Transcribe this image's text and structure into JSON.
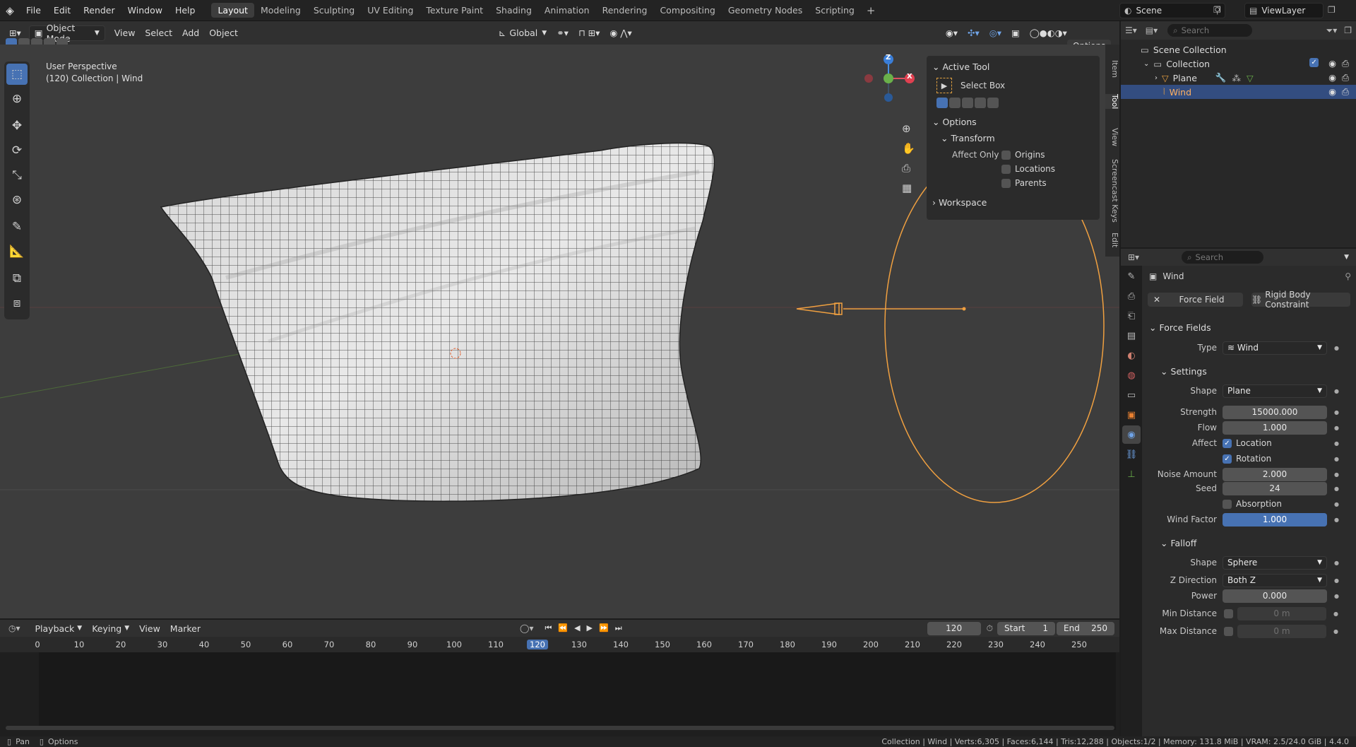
{
  "topbar": {
    "menus": [
      "File",
      "Edit",
      "Render",
      "Window",
      "Help"
    ],
    "workspaces": [
      "Layout",
      "Modeling",
      "Sculpting",
      "UV Editing",
      "Texture Paint",
      "Shading",
      "Animation",
      "Rendering",
      "Compositing",
      "Geometry Nodes",
      "Scripting"
    ],
    "active_workspace": "Layout",
    "scene": "Scene",
    "view_layer": "ViewLayer"
  },
  "viewport_header": {
    "mode": "Object Mode",
    "menus": [
      "View",
      "Select",
      "Add",
      "Object"
    ],
    "orientation": "Global",
    "options": "Options"
  },
  "viewport": {
    "view_name": "User Perspective",
    "context": "(120) Collection | Wind",
    "gizmo": {
      "z": "Z",
      "x": "X"
    }
  },
  "npanel": {
    "active_tool_title": "Active Tool",
    "tool_name": "Select Box",
    "options_title": "Options",
    "transform_title": "Transform",
    "affect_only": "Affect Only",
    "affect_items": [
      "Origins",
      "Locations",
      "Parents"
    ],
    "workspace_title": "Workspace",
    "tabs": [
      "Item",
      "Tool",
      "View",
      "Screencast Keys",
      "Edit"
    ]
  },
  "outliner": {
    "search_placeholder": "Search",
    "root": "Scene Collection",
    "collection": "Collection",
    "objects": [
      {
        "name": "Plane",
        "selected": false
      },
      {
        "name": "Wind",
        "selected": true
      }
    ]
  },
  "properties": {
    "search_placeholder": "Search",
    "object_name": "Wind",
    "tab_force_field": "Force Field",
    "tab_rigid": "Rigid Body Constraint",
    "section_force_fields": "Force Fields",
    "type_label": "Type",
    "type_value": "Wind",
    "section_settings": "Settings",
    "shape_label": "Shape",
    "shape_value": "Plane",
    "strength_label": "Strength",
    "strength_value": "15000.000",
    "flow_label": "Flow",
    "flow_value": "1.000",
    "affect_label": "Affect",
    "affect_location": "Location",
    "affect_rotation": "Rotation",
    "noise_label": "Noise Amount",
    "noise_value": "2.000",
    "seed_label": "Seed",
    "seed_value": "24",
    "absorption": "Absorption",
    "wind_factor_label": "Wind Factor",
    "wind_factor_value": "1.000",
    "section_falloff": "Falloff",
    "falloff_shape_label": "Shape",
    "falloff_shape_value": "Sphere",
    "zdir_label": "Z Direction",
    "zdir_value": "Both Z",
    "power_label": "Power",
    "power_value": "0.000",
    "min_dist_label": "Min Distance",
    "min_dist_value": "0 m",
    "max_dist_label": "Max Distance",
    "max_dist_value": "0 m"
  },
  "timeline": {
    "menus": [
      "Playback",
      "Keying",
      "View",
      "Marker"
    ],
    "current_frame": "120",
    "start_label": "Start",
    "start_value": "1",
    "end_label": "End",
    "end_value": "250",
    "ruler": [
      "0",
      "10",
      "20",
      "30",
      "40",
      "50",
      "60",
      "70",
      "80",
      "90",
      "100",
      "110",
      "120",
      "130",
      "140",
      "150",
      "160",
      "170",
      "180",
      "190",
      "200",
      "210",
      "220",
      "230",
      "240",
      "250"
    ]
  },
  "statusbar": {
    "pan": "Pan",
    "options": "Options",
    "stats": "Collection | Wind | Verts:6,305 | Faces:6,144 | Tris:12,288 | Objects:1/2 | Memory: 131.8 MiB | VRAM: 2.5/24.0 GiB | 4.4.0"
  },
  "colors": {
    "accent": "#4772b3",
    "selection": "#f0a040",
    "header": "#303030",
    "viewport": "#3d3d3d"
  }
}
